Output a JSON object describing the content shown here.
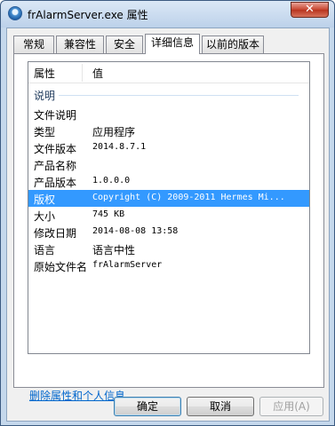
{
  "window": {
    "title": "frAlarmServer.exe 属性",
    "close_glyph": "✕"
  },
  "tabs": [
    {
      "label": "常规"
    },
    {
      "label": "兼容性"
    },
    {
      "label": "安全"
    },
    {
      "label": "详细信息",
      "active": true
    },
    {
      "label": "以前的版本"
    }
  ],
  "list": {
    "columns": {
      "property": "属性",
      "value": "值"
    },
    "group": "说明",
    "rows": [
      {
        "name": "文件说明",
        "value": ""
      },
      {
        "name": "类型",
        "value": "应用程序"
      },
      {
        "name": "文件版本",
        "value": "2014.8.7.1"
      },
      {
        "name": "产品名称",
        "value": ""
      },
      {
        "name": "产品版本",
        "value": "1.0.0.0"
      },
      {
        "name": "版权",
        "value": "Copyright (C) 2009-2011 Hermes Mi...",
        "selected": true
      },
      {
        "name": "大小",
        "value": "745 KB"
      },
      {
        "name": "修改日期",
        "value": "2014-08-08 13:58"
      },
      {
        "name": "语言",
        "value": "语言中性"
      },
      {
        "name": "原始文件名",
        "value": "frAlarmServer"
      }
    ]
  },
  "link": "删除属性和个人信息",
  "buttons": {
    "ok": "确定",
    "cancel": "取消",
    "apply": "应用(A)"
  },
  "colors": {
    "selection": "#3399ff",
    "link": "#0066cc",
    "group_text": "#1e395b"
  },
  "icons": {
    "app": "app-icon",
    "close": "close-icon"
  }
}
